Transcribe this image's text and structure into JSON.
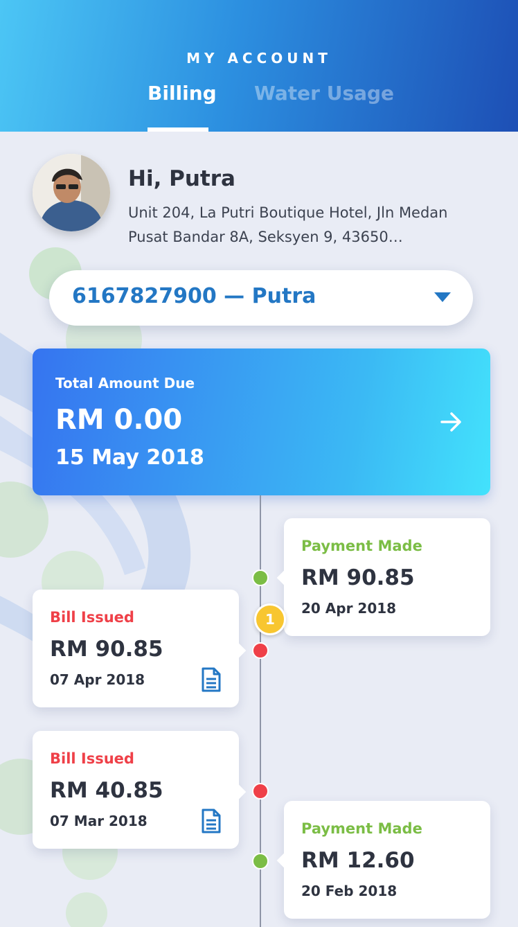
{
  "header": {
    "title": "MY ACCOUNT",
    "tabs": [
      {
        "label": "Billing",
        "active": true
      },
      {
        "label": "Water Usage",
        "active": false
      }
    ]
  },
  "profile": {
    "greeting": "Hi, Putra",
    "address": "Unit 204, La Putri Boutique Hotel, Jln Medan Pusat Bandar 8A, Seksyen 9, 43650…"
  },
  "account_select": {
    "value": "6167827900 — Putra"
  },
  "total": {
    "label": "Total Amount Due",
    "amount": "RM 0.00",
    "date": "15 May 2018"
  },
  "timeline": {
    "badge_count": "1",
    "entries": [
      {
        "type": "payment",
        "label": "Payment Made",
        "amount": "RM 90.85",
        "date": "20 Apr 2018"
      },
      {
        "type": "bill",
        "label": "Bill Issued",
        "amount": "RM 90.85",
        "date": "07 Apr 2018"
      },
      {
        "type": "bill",
        "label": "Bill Issued",
        "amount": "RM 40.85",
        "date": "07 Mar 2018"
      },
      {
        "type": "payment",
        "label": "Payment Made",
        "amount": "RM 12.60",
        "date": "20 Feb 2018"
      }
    ]
  },
  "colors": {
    "accent_blue": "#2377c4",
    "payment_green": "#7bbd45",
    "bill_red": "#ef4048",
    "badge_yellow": "#f8c630"
  },
  "icons": [
    "arrow-right-icon",
    "chevron-down-icon",
    "document-icon"
  ]
}
